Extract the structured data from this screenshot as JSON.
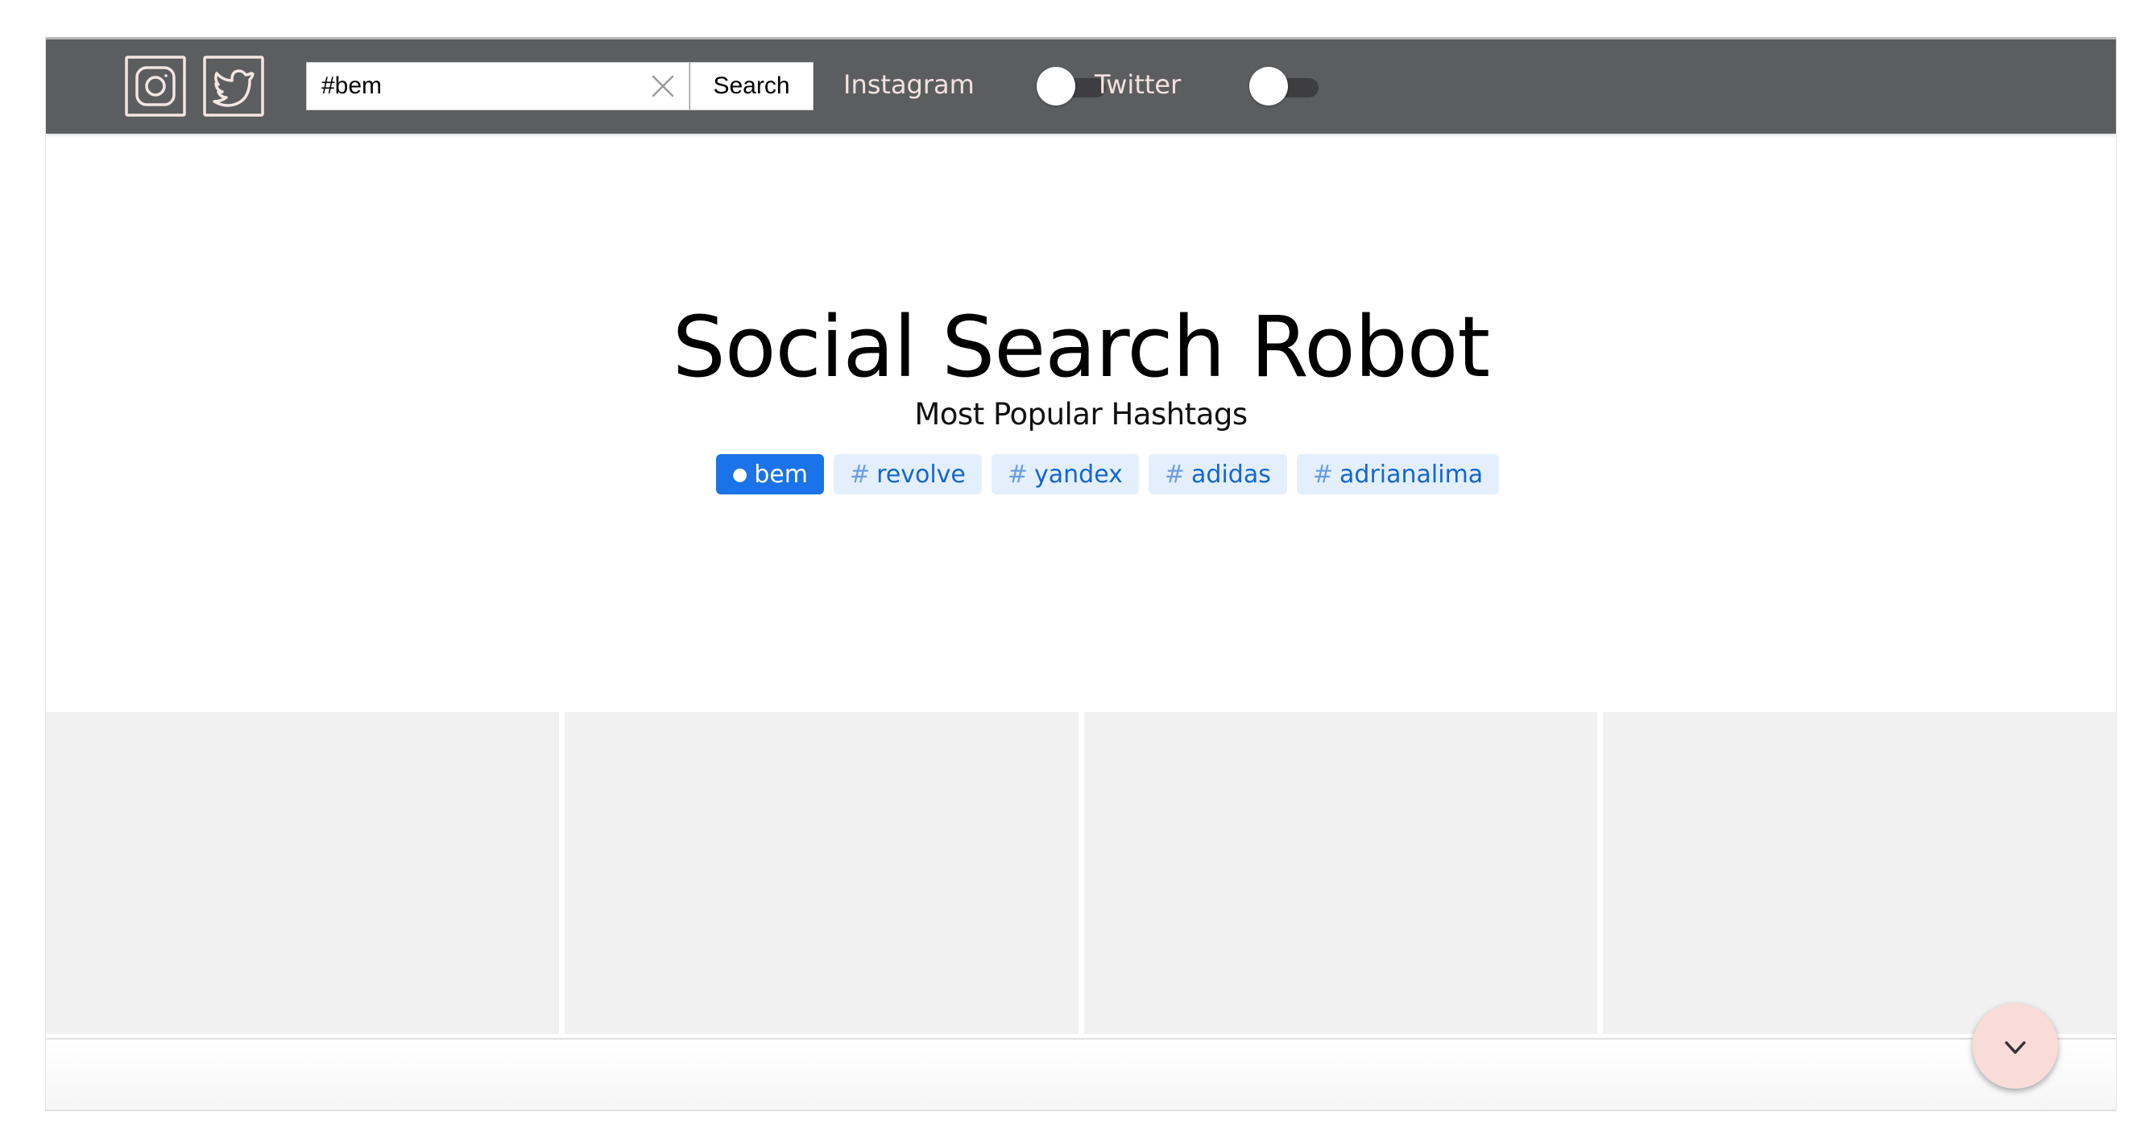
{
  "header": {
    "logos": [
      {
        "icon": "instagram-icon"
      },
      {
        "icon": "twitter-icon"
      }
    ],
    "search": {
      "value": "#bem",
      "button_label": "Search"
    },
    "filters": [
      {
        "label": "Instagram",
        "enabled": false
      },
      {
        "label": "Twitter",
        "enabled": false
      }
    ]
  },
  "hero": {
    "title": "Social Search Robot",
    "subtitle": "Most Popular Hashtags",
    "tags": [
      {
        "mark": "●",
        "text": "bem",
        "active": true
      },
      {
        "mark": "#",
        "text": "revolve",
        "active": false
      },
      {
        "mark": "#",
        "text": "yandex",
        "active": false
      },
      {
        "mark": "#",
        "text": "adidas",
        "active": false
      },
      {
        "mark": "#",
        "text": "adrianalima",
        "active": false
      }
    ]
  },
  "results": {
    "placeholder_count": 4
  },
  "scroll_button": {
    "icon": "chevron-down-icon"
  },
  "colors": {
    "header_bg": "#5c5d5f",
    "tag_active_bg": "#1a73e8",
    "tag_bg": "#e4effd",
    "tag_text": "#1466d0",
    "scroll_button_bg": "#f9dcd8",
    "placeholder_bg": "#f1f1f1"
  }
}
